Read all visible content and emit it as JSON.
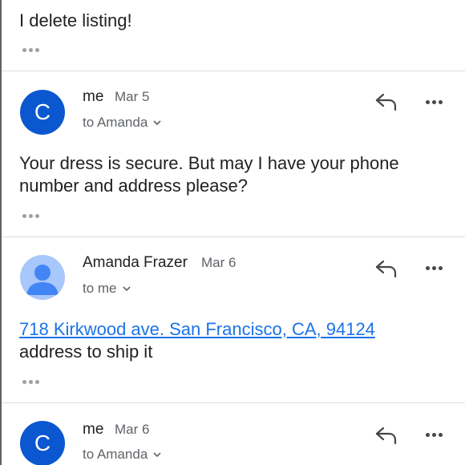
{
  "top_message": {
    "body": "I delete listing!"
  },
  "messages": [
    {
      "avatar_letter": "C",
      "avatar_color": "#0b57d0",
      "sender": "me",
      "date": "Mar 5",
      "recipient": "to Amanda",
      "body_line1": "Your dress is secure. But may I have your phone",
      "body_line2": "number and address please?"
    },
    {
      "avatar_icon": "person-icon",
      "sender": "Amanda Frazer",
      "date": "Mar 6",
      "recipient": "to me",
      "link": "718 Kirkwood ave. San Francisco, CA, 94124",
      "body": "address to ship it"
    },
    {
      "avatar_letter": "C",
      "avatar_color": "#0b57d0",
      "sender": "me",
      "date": "Mar 6",
      "recipient": "to Amanda"
    }
  ],
  "icons": {
    "reply": "reply-icon",
    "more": "more-horizontal-icon",
    "expand": "ellipsis-icon",
    "chevron": "chevron-down-icon"
  },
  "colors": {
    "link": "#1a73e8",
    "avatar_letter_bg": "#0b57d0",
    "avatar_photo_bg": "#a8c7fa",
    "avatar_photo_fg": "#4285f4"
  }
}
